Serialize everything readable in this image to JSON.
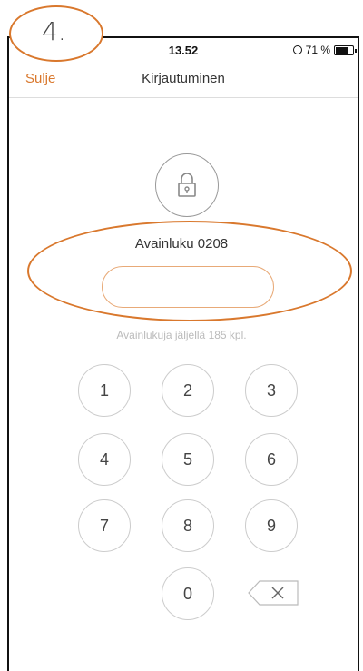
{
  "annotation": {
    "step_label": "4."
  },
  "status_bar": {
    "time": "13.52",
    "battery_text": "71 %",
    "battery_level": 0.71
  },
  "nav": {
    "close_label": "Sulje",
    "title": "Kirjautuminen"
  },
  "key": {
    "label": "Avainluku 0208",
    "input_value": "",
    "remaining_text": "Avainlukuja jäljellä 185 kpl."
  },
  "keypad": {
    "digits": [
      "1",
      "2",
      "3",
      "4",
      "5",
      "6",
      "7",
      "8",
      "9",
      "0"
    ],
    "backspace_icon": "backspace-icon"
  },
  "colors": {
    "accent": "#d9782d",
    "input_border": "#e8aa78"
  }
}
